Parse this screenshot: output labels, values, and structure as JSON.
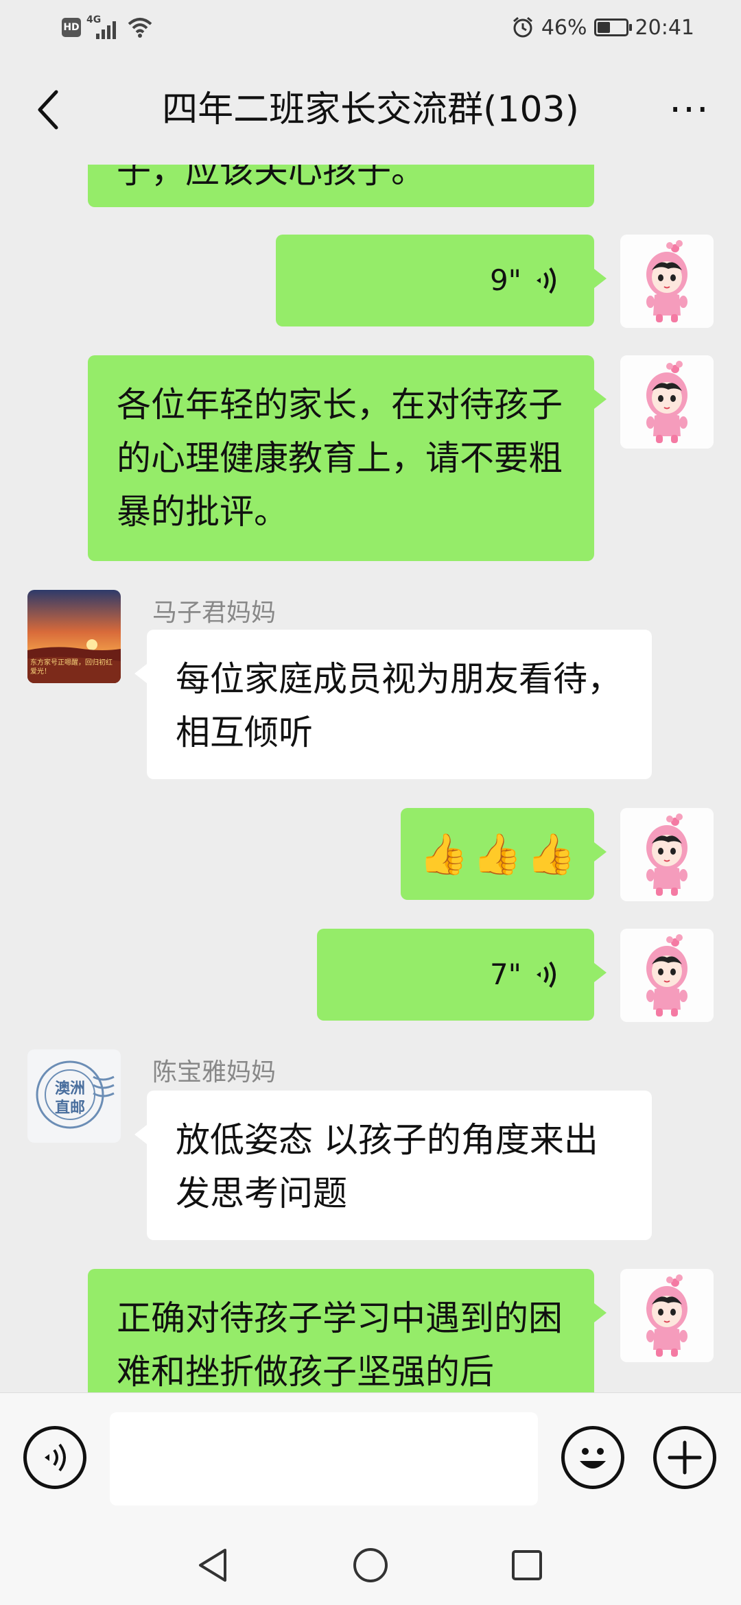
{
  "status_bar": {
    "hd": "HD",
    "network": "4G",
    "battery_percent": "46%",
    "battery_level": 0.46,
    "time": "20:41"
  },
  "header": {
    "title": "四年二班家长交流群(103)",
    "more": "···"
  },
  "messages": [
    {
      "type": "text",
      "side": "right",
      "text": "子，应该关心孩子。"
    },
    {
      "type": "voice",
      "side": "right",
      "duration": "9\""
    },
    {
      "type": "text",
      "side": "right",
      "text": "各位年轻的家长，在对待孩子的心理健康教育上，请不要粗暴的批评。"
    },
    {
      "type": "text",
      "side": "left",
      "sender": "马子君妈妈",
      "avatar_caption": "东方家号正嗯醒，回归初红爱光！",
      "text": "每位家庭成员视为朋友看待，相互倾听"
    },
    {
      "type": "emoji",
      "side": "right",
      "emojis": [
        "👍",
        "👍",
        "👍"
      ]
    },
    {
      "type": "voice",
      "side": "right",
      "duration": "7\""
    },
    {
      "type": "text",
      "side": "left",
      "sender": "陈宝雅妈妈",
      "avatar_caption": "澳洲直邮",
      "text": "放低姿态 以孩子的角度来出发思考问题"
    },
    {
      "type": "text",
      "side": "right",
      "text": "正确对待孩子学习中遇到的困难和挫折做孩子坚强的后"
    }
  ],
  "input_bar": {
    "placeholder": ""
  },
  "colors": {
    "green_bubble": "#95ec69",
    "background": "#ededed",
    "white_bubble": "#ffffff"
  },
  "icons": [
    "back-arrow-icon",
    "more-dots-icon",
    "voice-input-icon",
    "emoji-icon",
    "plus-icon",
    "nav-back-icon",
    "nav-home-icon",
    "nav-recents-icon",
    "voice-wave-icon",
    "thumbs-up-icon"
  ]
}
